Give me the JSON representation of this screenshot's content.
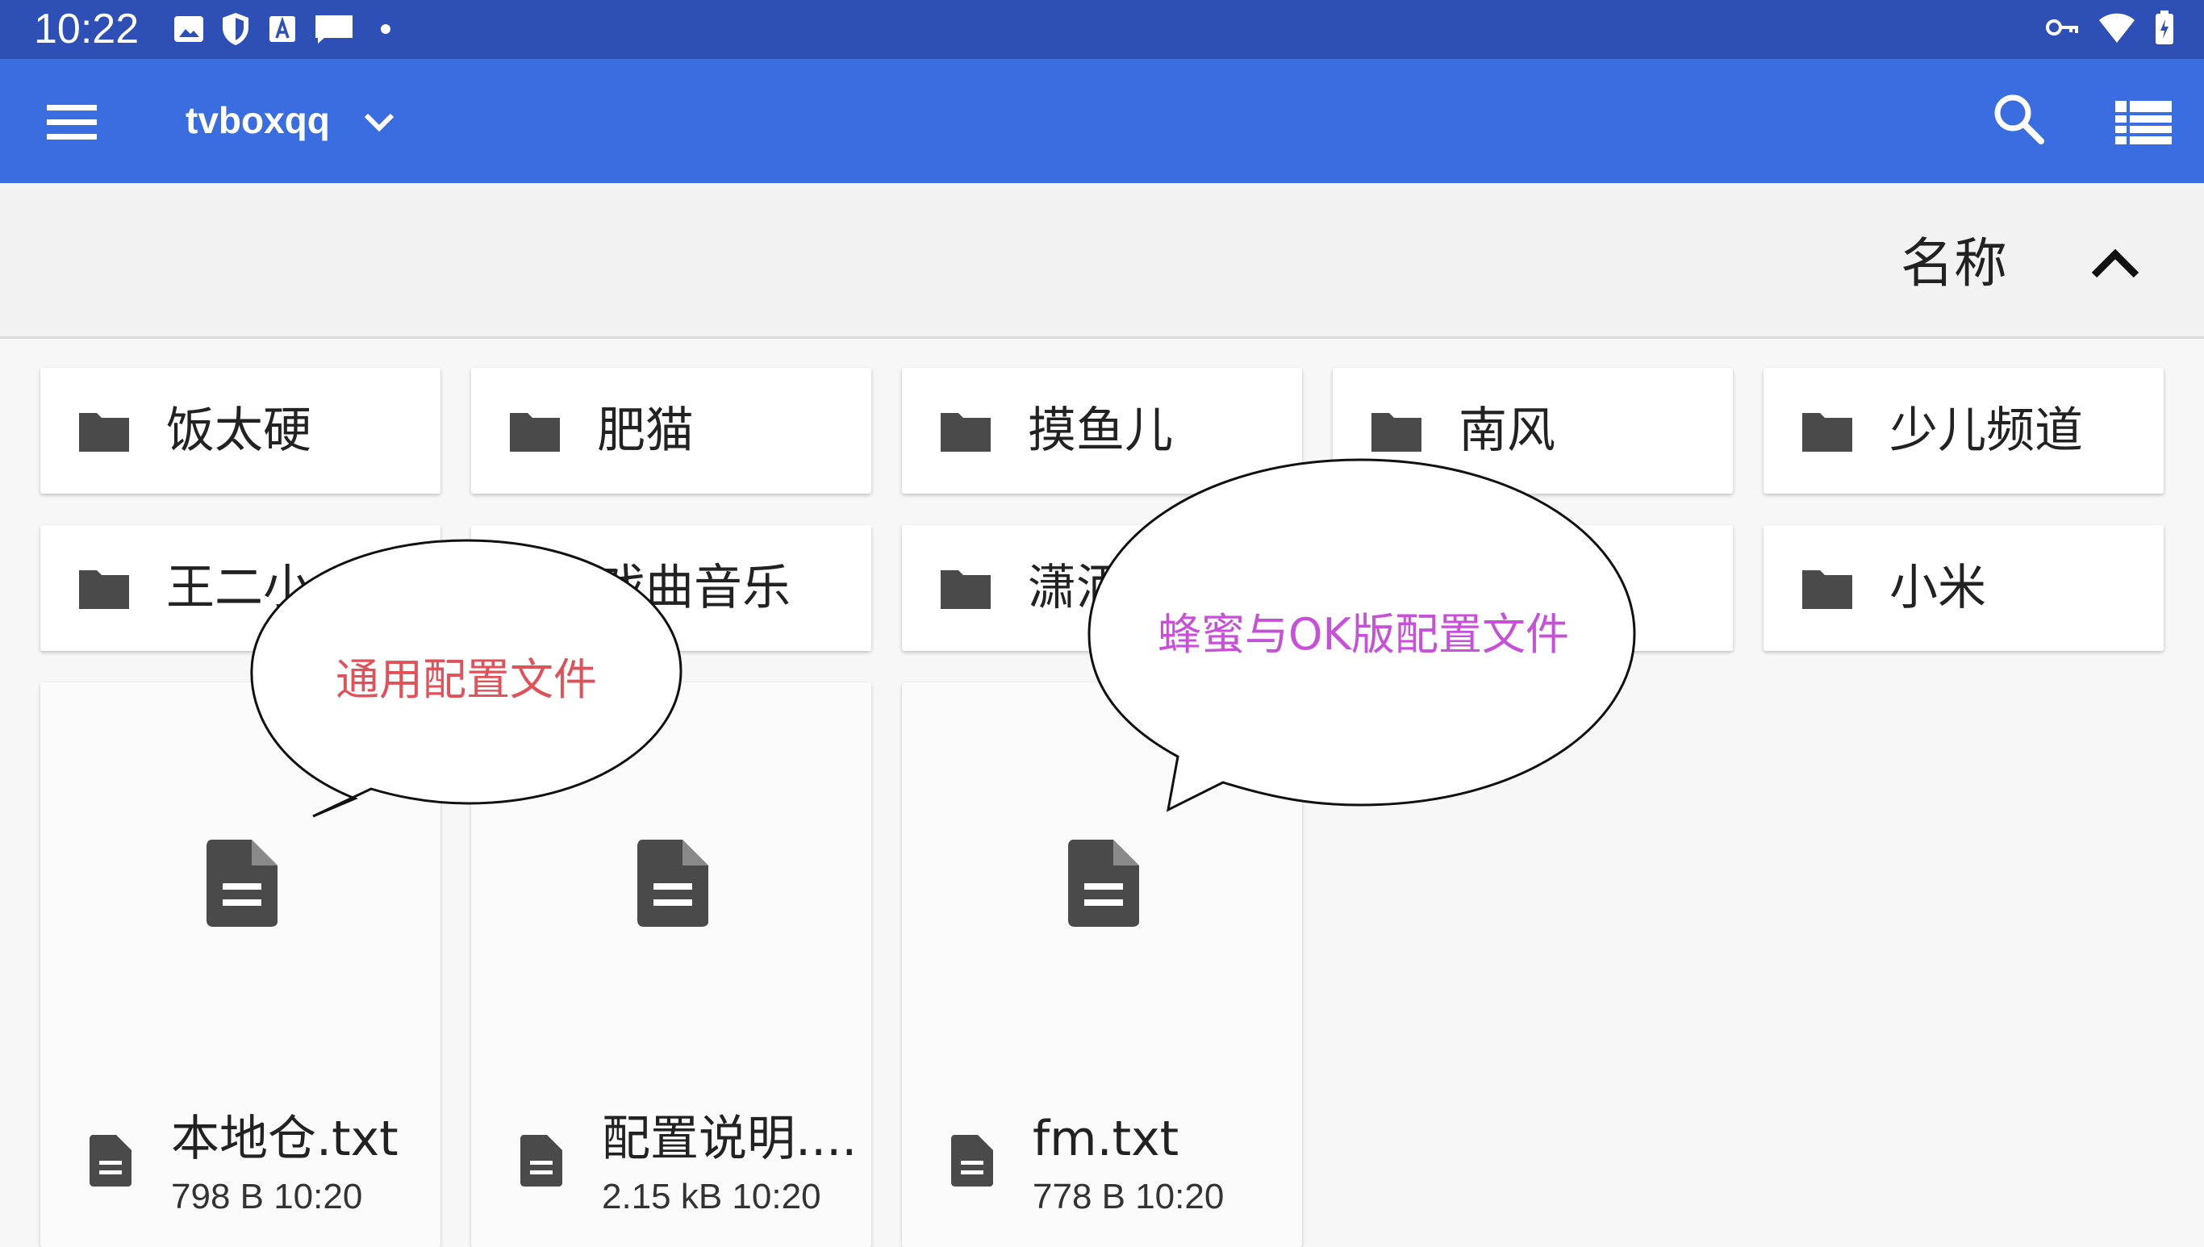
{
  "status_bar": {
    "time": "10:22",
    "left_icons": [
      "image-icon",
      "shield-icon",
      "font-icon",
      "message-icon",
      "dot-icon"
    ],
    "right_icons": [
      "key-icon",
      "wifi-icon",
      "battery-icon"
    ]
  },
  "app_bar": {
    "title": "tvboxqq",
    "icons": [
      "menu-icon",
      "chevron-down-icon",
      "search-icon",
      "list-view-icon"
    ]
  },
  "sort_bar": {
    "label": "名称",
    "icon": "chevron-up-icon"
  },
  "folders": [
    {
      "name": "饭太硬"
    },
    {
      "name": "肥猫"
    },
    {
      "name": "摸鱼儿"
    },
    {
      "name": "南风"
    },
    {
      "name": "少儿频道"
    },
    {
      "name": "王二小"
    },
    {
      "name": "戏曲音乐"
    },
    {
      "name": "潇洒"
    },
    {
      "name": ""
    },
    {
      "name": "小米"
    }
  ],
  "files": [
    {
      "name": "本地仓.txt",
      "meta": "798 B 10:20"
    },
    {
      "name": "配置说明....",
      "meta": "2.15 kB 10:20"
    },
    {
      "name": "fm.txt",
      "meta": "778 B 10:20"
    }
  ],
  "annotations": [
    {
      "text": "通用配置文件",
      "color": "#e0525a"
    },
    {
      "text": "蜂蜜与OK版配置文件",
      "color": "#c84fd8"
    }
  ],
  "colors": {
    "status_bar": "#2d4fb6",
    "app_bar": "#3a6ee0",
    "folder_icon": "#4a4a4a"
  }
}
